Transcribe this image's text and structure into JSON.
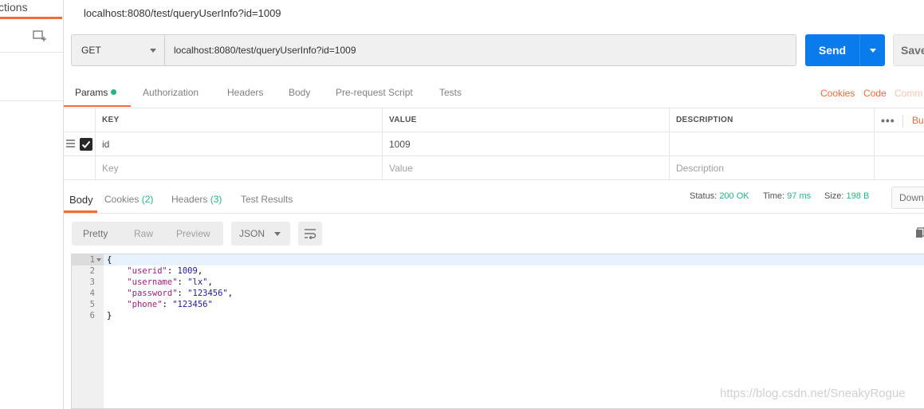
{
  "sidebar": {
    "tab_label": "ctions",
    "new_collection_icon": "new-collection-icon"
  },
  "request": {
    "tab_title": "localhost:8080/test/queryUserInfo?id=1009",
    "method": "GET",
    "url": "localhost:8080/test/queryUserInfo?id=1009",
    "send_label": "Send",
    "save_label": "Save"
  },
  "req_tabs": {
    "params": "Params",
    "authorization": "Authorization",
    "headers": "Headers",
    "body": "Body",
    "prerequest": "Pre-request Script",
    "tests": "Tests",
    "cookies": "Cookies",
    "code": "Code",
    "comments": "Comm"
  },
  "params_table": {
    "headers": {
      "key": "KEY",
      "value": "VALUE",
      "description": "DESCRIPTION",
      "more": "•••",
      "bulk": "Bu"
    },
    "rows": [
      {
        "key": "id",
        "value": "1009",
        "description": ""
      }
    ],
    "placeholders": {
      "key": "Key",
      "value": "Value",
      "description": "Description"
    }
  },
  "response": {
    "tabs": {
      "body": "Body",
      "cookies": "Cookies",
      "cookies_count": "(2)",
      "headers": "Headers",
      "headers_count": "(3)",
      "tests": "Test Results"
    },
    "status_label": "Status:",
    "status_value": "200 OK",
    "time_label": "Time:",
    "time_value": "97 ms",
    "size_label": "Size:",
    "size_value": "198 B",
    "download_label": "Down"
  },
  "body_toolbar": {
    "pretty": "Pretty",
    "raw": "Raw",
    "preview": "Preview",
    "format": "JSON"
  },
  "code": {
    "lines": [
      "1",
      "2",
      "3",
      "4",
      "5",
      "6"
    ],
    "open_brace": "{",
    "close_brace": "}",
    "fields": [
      {
        "key": "\"userid\"",
        "value": "1009",
        "type": "number",
        "comma": ","
      },
      {
        "key": "\"username\"",
        "value": "\"lx\"",
        "type": "string",
        "comma": ","
      },
      {
        "key": "\"password\"",
        "value": "\"123456\"",
        "type": "string",
        "comma": ","
      },
      {
        "key": "\"phone\"",
        "value": "\"123456\"",
        "type": "string",
        "comma": ""
      }
    ]
  },
  "watermark": "https://blog.csdn.net/SneakyRogue",
  "colors": {
    "accent": "#f26b3a",
    "send": "#097bed",
    "success": "#26b47f"
  }
}
